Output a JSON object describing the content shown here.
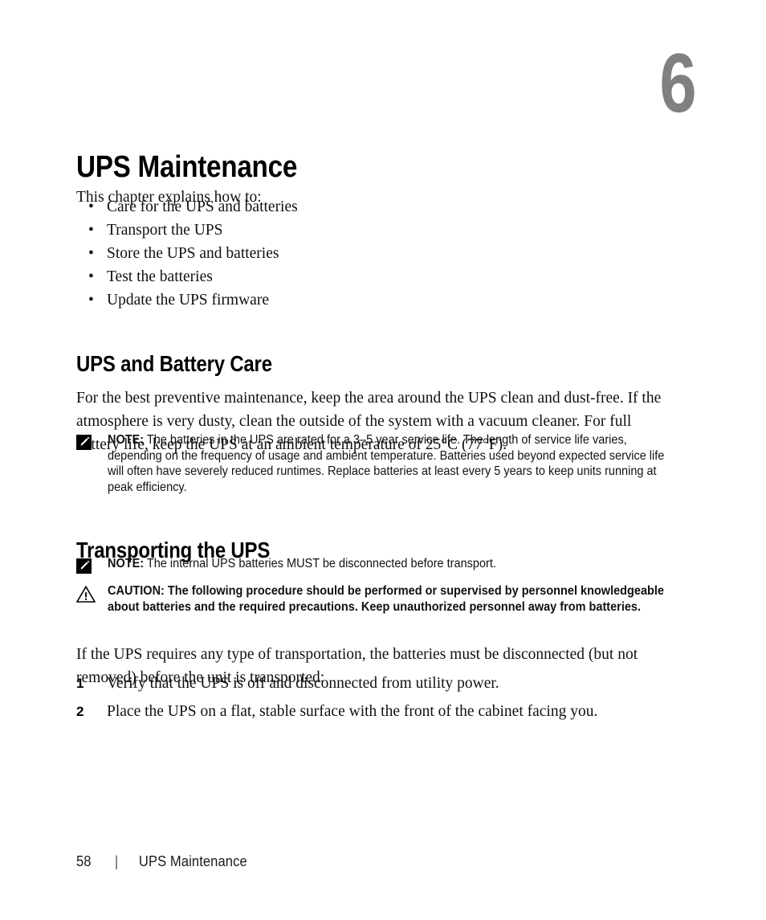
{
  "chapter": {
    "number": "6",
    "title": "UPS Maintenance",
    "intro": "This chapter explains how to:",
    "topics": [
      "Care for the UPS and batteries",
      "Transport the UPS",
      "Store the UPS and batteries",
      "Test the batteries",
      "Update the UPS firmware"
    ]
  },
  "sections": {
    "care": {
      "heading": "UPS and Battery Care",
      "paragraph": "For the best preventive maintenance, keep the area around the UPS clean and dust-free. If the atmosphere is very dusty, clean the outside of the system with a vacuum cleaner. For full battery life, keep the UPS at an ambient temperature of 25°C (77°F).",
      "note": {
        "label": "NOTE:",
        "icon": "note-pencil-icon",
        "text": " The batteries in the UPS are rated for a 3–5 year service life. The length of service life varies, depending on the frequency of usage and ambient temperature. Batteries used beyond expected service life will often have severely reduced runtimes. Replace batteries at least every 5 years to keep units running at peak efficiency."
      }
    },
    "transport": {
      "heading": "Transporting the UPS",
      "note": {
        "label": "NOTE:",
        "icon": "note-pencil-icon",
        "text": " The internal UPS batteries MUST be disconnected before transport."
      },
      "caution": {
        "label": "CAUTION:",
        "icon": "warning-triangle-icon",
        "text": " The following procedure should be performed or supervised by personnel knowledgeable about batteries and the required precautions. Keep unauthorized personnel away from batteries."
      },
      "paragraph": "If the UPS requires any type of transportation, the batteries must be disconnected (but not removed) before the unit is transported:",
      "steps": [
        {
          "number": "1",
          "text": "Verify that the UPS is off and disconnected from utility power."
        },
        {
          "number": "2",
          "text": "Place the UPS on a flat, stable surface with the front of the cabinet facing you."
        }
      ]
    }
  },
  "footer": {
    "page_number": "58",
    "separator": "|",
    "title": "UPS Maintenance"
  },
  "colors": {
    "chapter_number": "#808080",
    "text": "#000000",
    "background": "#ffffff"
  },
  "bullet_glyph": "•"
}
